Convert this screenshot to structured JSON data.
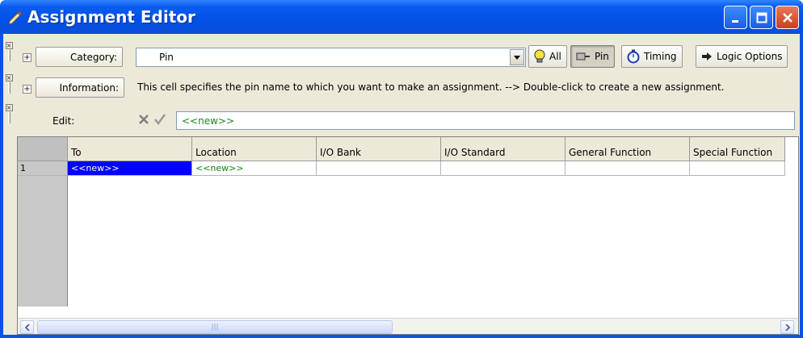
{
  "window": {
    "title": "Assignment Editor"
  },
  "category_row": {
    "label": "Category:",
    "selected": "Pin",
    "buttons": {
      "all": "All",
      "pin": "Pin",
      "timing": "Timing",
      "logic_options": "Logic Options"
    }
  },
  "information_row": {
    "label": "Information:",
    "text": "This cell specifies the pin name to which you want to make an assignment.   --> Double-click to create a new assignment."
  },
  "edit_row": {
    "label": "Edit:",
    "value": "<<new>>"
  },
  "grid": {
    "columns": [
      "To",
      "Location",
      "I/O Bank",
      "I/O Standard",
      "General Function",
      "Special Function"
    ],
    "rows": [
      {
        "num": "1",
        "to": "<<new>>",
        "location": "<<new>>",
        "io_bank": "",
        "io_standard": "",
        "general_function": "",
        "special_function": ""
      }
    ],
    "scroll_thumb": "|||"
  },
  "colors": {
    "title_blue": "#0a54e3",
    "selection": "#0000ff",
    "new_text": "#0a8a0a",
    "face": "#ece9d8"
  }
}
